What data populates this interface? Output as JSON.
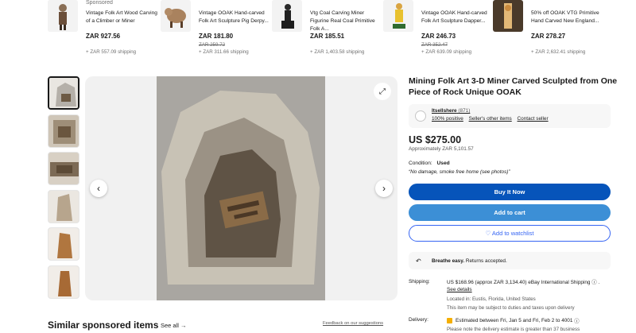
{
  "sponsored": {
    "label": "Sponsored",
    "items": [
      {
        "title": "Vintage Folk Art Wood Carving of a Climber or Miner",
        "price": "ZAR 927.56",
        "was": "",
        "shipping": "+ ZAR 557.09 shipping"
      },
      {
        "title": "Vintage OOAK Hand-carved Folk Art Sculpture Pig Derpy...",
        "price": "ZAR 181.80",
        "was": "ZAR 259.72",
        "shipping": "+ ZAR 311.66 shipping"
      },
      {
        "title": "Vtg Coal Carving Miner Figurine Real Coal Primitive Folk A...",
        "price": "ZAR 185.51",
        "was": "",
        "shipping": "+ ZAR 1,403.58 shipping"
      },
      {
        "title": "Vintage OOAK Hand-carved Folk Art Sculpture Dapper...",
        "price": "ZAR 246.73",
        "was": "ZAR 352.47",
        "shipping": "+ ZAR 639.09 shipping"
      },
      {
        "title": "50% off OOAK VTG Primitive Hand Carved New England...",
        "price": "ZAR 278.27",
        "was": "",
        "shipping": "+ ZAR 2,632.41 shipping"
      }
    ]
  },
  "gallery": {
    "thumb_count": 6,
    "prev_icon": "chevron-left-icon",
    "next_icon": "chevron-right-icon",
    "expand_icon": "expand-icon"
  },
  "listing": {
    "title": "Mining Folk Art 3-D Miner Carved Sculpted from One Piece of Rock Unique OOAK",
    "seller": {
      "name": "Itsellshere",
      "count": "(871)",
      "positive": "100% positive",
      "other_items": "Seller's other items",
      "contact": "Contact seller"
    },
    "price": "US $275.00",
    "approx": "Approximately ZAR 5,101.57",
    "condition_label": "Condition:",
    "condition_value": "Used",
    "condition_note": "“No damage, smoke free home (see photos)”",
    "buy_now": "Buy It Now",
    "add_to_cart": "Add to cart",
    "add_to_watchlist": "♡ Add to watchlist",
    "returns": {
      "strong": "Breathe easy.",
      "text": "Returns accepted."
    },
    "shipping": {
      "label": "Shipping:",
      "main": "US $168.96 (approx ZAR 3,134.40) eBay International Shipping",
      "see_details": "See details",
      "location": "Located in: Eustis, Florida, United States",
      "duties": "This item may be subject to duties and taxes upon delivery"
    },
    "delivery": {
      "label": "Delivery:",
      "main": "Estimated between Fri, Jan 5 and Fri, Feb 2 to 4001",
      "note": "Please note the delivery estimate is greater than 37 business"
    }
  },
  "similar": {
    "title": "Similar sponsored items",
    "see_all": "See all",
    "feedback": "Feedback on our suggestions"
  },
  "colors": {
    "buy_button": "#0654ba",
    "cart_button": "#3c8fd6",
    "link_blue": "#3665f3"
  }
}
